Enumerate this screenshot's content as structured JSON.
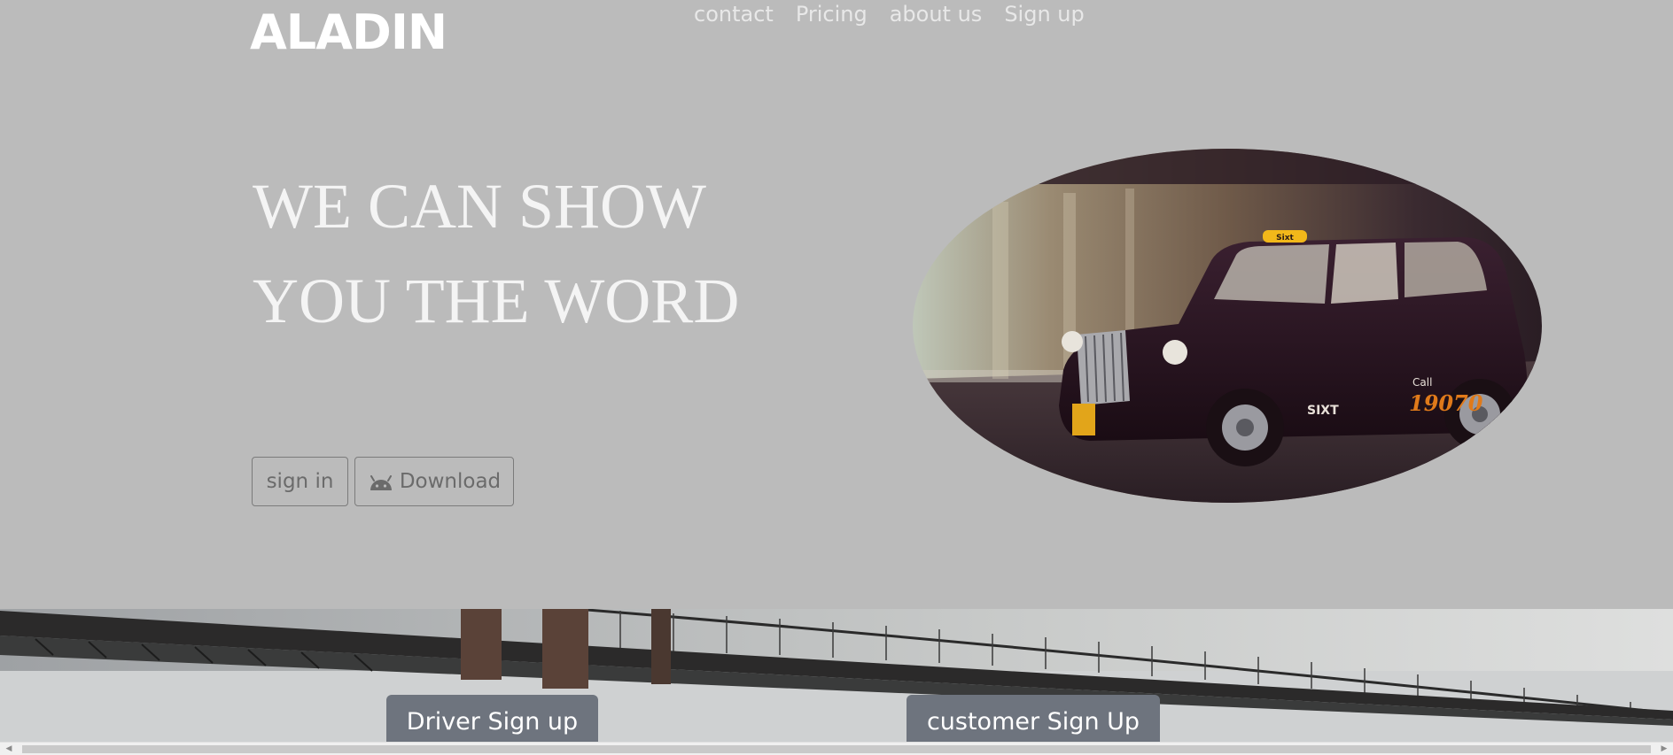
{
  "header": {
    "logo": "ALADIN",
    "nav": [
      {
        "label": "contact"
      },
      {
        "label": "Pricing"
      },
      {
        "label": "about us"
      },
      {
        "label": "Sign up"
      }
    ]
  },
  "hero": {
    "headline_line1": "WE CAN SHOW",
    "headline_line2": "YOU THE WORD",
    "signin_label": "sign in",
    "download_label": "Download",
    "download_icon": "android-icon"
  },
  "taxi_image": {
    "roof_sign": "Sixt",
    "door_call": "Call",
    "door_number": "19070",
    "door_brand": "SIXT"
  },
  "signup": {
    "driver_label": "Driver Sign up",
    "customer_label": "customer Sign Up"
  },
  "colors": {
    "page_background": "#bbbbbb",
    "button_dark": "#6e747e",
    "text_light": "#f4f4f4"
  }
}
